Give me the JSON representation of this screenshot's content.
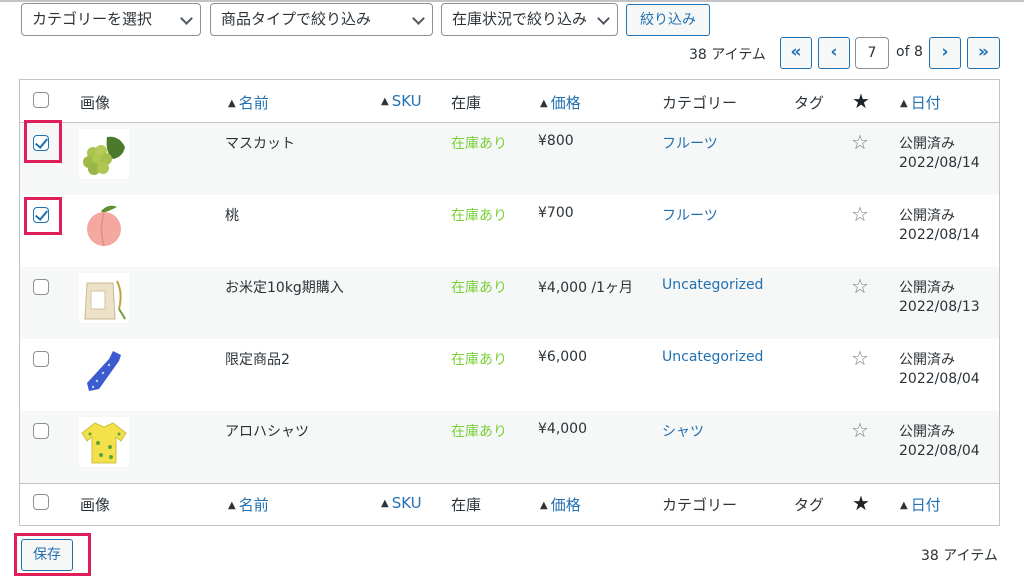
{
  "filters": {
    "category": "カテゴリーを選択",
    "product_type": "商品タイプで絞り込み",
    "stock_status": "在庫状況で絞り込み",
    "filter_button": "絞り込み"
  },
  "pagination": {
    "items_count": "38 アイテム",
    "first": "«",
    "prev": "‹",
    "current_page": "7",
    "of_label": "of 8",
    "next": "›",
    "last": "»"
  },
  "table": {
    "columns": {
      "image": "画像",
      "name": "名前",
      "sku": "SKU",
      "stock": "在庫",
      "price": "価格",
      "category": "カテゴリー",
      "tags": "タグ",
      "date": "日付"
    },
    "rows": [
      {
        "checked": true,
        "thumb": "grapes-image",
        "name": "マスカット",
        "stock": "在庫あり",
        "price": "¥800",
        "category": "フルーツ",
        "status": "公開済み",
        "date": "2022/08/14"
      },
      {
        "checked": true,
        "thumb": "peach-image",
        "name": "桃",
        "stock": "在庫あり",
        "price": "¥700",
        "category": "フルーツ",
        "status": "公開済み",
        "date": "2022/08/14"
      },
      {
        "checked": false,
        "thumb": "rice-bag-image",
        "name": "お米定10kg期購入",
        "stock": "在庫あり",
        "price": "¥4,000 /1ヶ月",
        "category": "Uncategorized",
        "status": "公開済み",
        "date": "2022/08/13"
      },
      {
        "checked": false,
        "thumb": "necktie-image",
        "name": "限定商品2",
        "stock": "在庫あり",
        "price": "¥6,000",
        "category": "Uncategorized",
        "status": "公開済み",
        "date": "2022/08/04"
      },
      {
        "checked": false,
        "thumb": "aloha-shirt-image",
        "name": "アロハシャツ",
        "stock": "在庫あり",
        "price": "¥4,000",
        "category": "シャツ",
        "status": "公開済み",
        "date": "2022/08/04"
      }
    ]
  },
  "footer": {
    "save_button": "保存",
    "items_count": "38 アイテム"
  },
  "colors": {
    "accent": "#2271b1",
    "in_stock": "#7ad03a",
    "highlight": "#e01f5a"
  }
}
